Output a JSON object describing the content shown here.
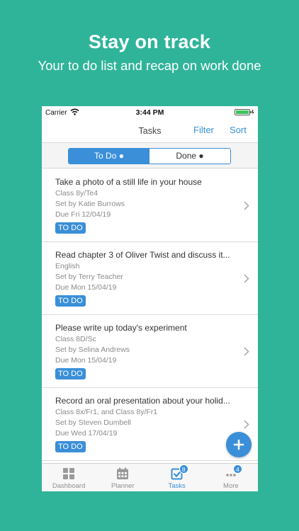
{
  "promo": {
    "headline": "Stay on track",
    "subline": "Your to do list and recap on work done"
  },
  "status_bar": {
    "carrier": "Carrier",
    "time": "3:44 PM"
  },
  "nav": {
    "title": "Tasks",
    "filter_label": "Filter",
    "sort_label": "Sort"
  },
  "segment": {
    "todo_label": "To Do ●",
    "done_label": "Done ●",
    "selected": "To Do"
  },
  "tasks": [
    {
      "title": "Take a photo of a still life in your house",
      "class": "Class 8y/Te4",
      "set_by": "Set by Katie Burrows",
      "due": "Due Fri 12/04/19",
      "status": "TO DO"
    },
    {
      "title": "Read chapter 3 of Oliver Twist and discuss it...",
      "class": "English",
      "set_by": "Set by Terry Teacher",
      "due": "Due Mon 15/04/19",
      "status": "TO DO"
    },
    {
      "title": "Please write up today's experiment",
      "class": "Class 8D/Sc",
      "set_by": "Set by Selina Andrews",
      "due": "Due Mon 15/04/19",
      "status": "TO DO"
    },
    {
      "title": "Record an oral presentation about your holid...",
      "class": "Class 8x/Fr1, and Class 8y/Fr1",
      "set_by": "Set by Steven Dumbell",
      "due": "Due Wed 17/04/19",
      "status": "TO DO"
    }
  ],
  "tab_bar": {
    "dashboard": {
      "label": "Dashboard"
    },
    "planner": {
      "label": "Planner"
    },
    "tasks": {
      "label": "Tasks",
      "badge": "8"
    },
    "more": {
      "label": "More",
      "badge": "4"
    }
  },
  "colors": {
    "background": "#2fb49a",
    "accent": "#3a8fd8",
    "battery": "#3fc35a"
  },
  "icons": [
    "wifi-icon",
    "battery-icon",
    "chevron-right-icon",
    "plus-icon",
    "dashboard-grid-icon",
    "calendar-icon",
    "checkbox-icon",
    "more-dots-icon"
  ]
}
